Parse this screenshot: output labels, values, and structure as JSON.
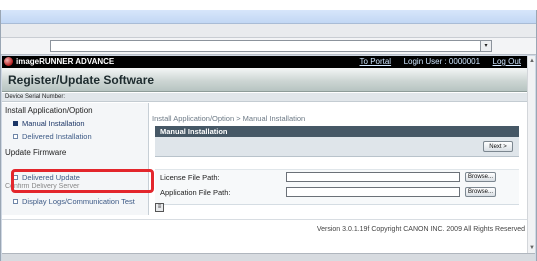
{
  "browser": {
    "address_dropdown_arrow": "▾"
  },
  "header": {
    "product": "imageRUNNER ADVANCE",
    "to_portal": "To Portal",
    "login_user": "Login User : 0000001",
    "log_out": "Log Out",
    "logo_icon": "canon-device-icon"
  },
  "page": {
    "title": "Register/Update Software",
    "device_serial_label": "Device Serial Number:"
  },
  "sidebar": {
    "section_install": "Install Application/Option",
    "item_manual": "Manual Installation",
    "item_delivered_install": "Delivered Installation",
    "section_update": "Update Firmware",
    "item_delivered_update": "Delivered Update",
    "section_hidden": "Confirm Delivery Server",
    "item_display_logs": "Display Logs/Communication Test"
  },
  "main": {
    "breadcrumb": "Install Application/Option > Manual Installation",
    "section_title": "Manual Installation",
    "next_button": "Next >",
    "license_label": "License File Path:",
    "license_value": "",
    "application_label": "Application File Path:",
    "application_value": "",
    "browse_label": "Browse..."
  },
  "footer": {
    "version": "Version 3.0.1.19f Copyright CANON INC. 2009 All Rights Reserved"
  },
  "colors": {
    "highlight": "#e3262c",
    "header_bg": "#000000",
    "section_title_bg": "#465866"
  }
}
